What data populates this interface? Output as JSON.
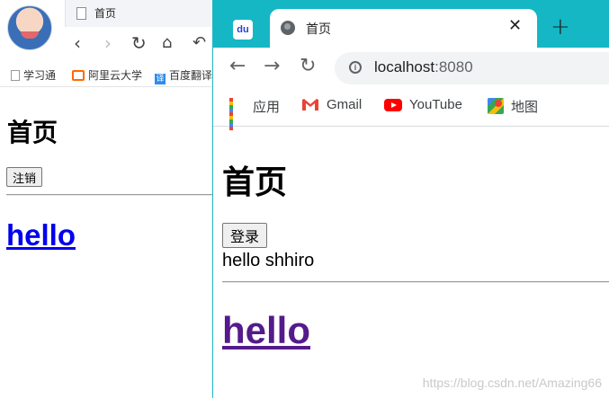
{
  "left_window": {
    "tab_title": "首页",
    "bookmarks": [
      "学习通",
      "阿里云大学",
      "百度翻译"
    ],
    "page": {
      "heading": "首页",
      "button_label": "注销",
      "link_text": "hello"
    }
  },
  "right_window": {
    "tab_title": "首页",
    "favicon_text": "du",
    "close_glyph": "✕",
    "new_tab_glyph": "+",
    "url_host": "localhost",
    "url_port": ":8080",
    "bookmarks": [
      "应用",
      "Gmail",
      "YouTube",
      "地图"
    ],
    "page": {
      "heading": "首页",
      "button_label": "登录",
      "greeting": "hello shhiro",
      "link_text": "hello"
    }
  },
  "watermark": "https://blog.csdn.net/Amazing66",
  "colors": {
    "chrome_teal": "#15b7c5",
    "link_unvisited": "#0000ee",
    "link_visited": "#551a8b"
  }
}
